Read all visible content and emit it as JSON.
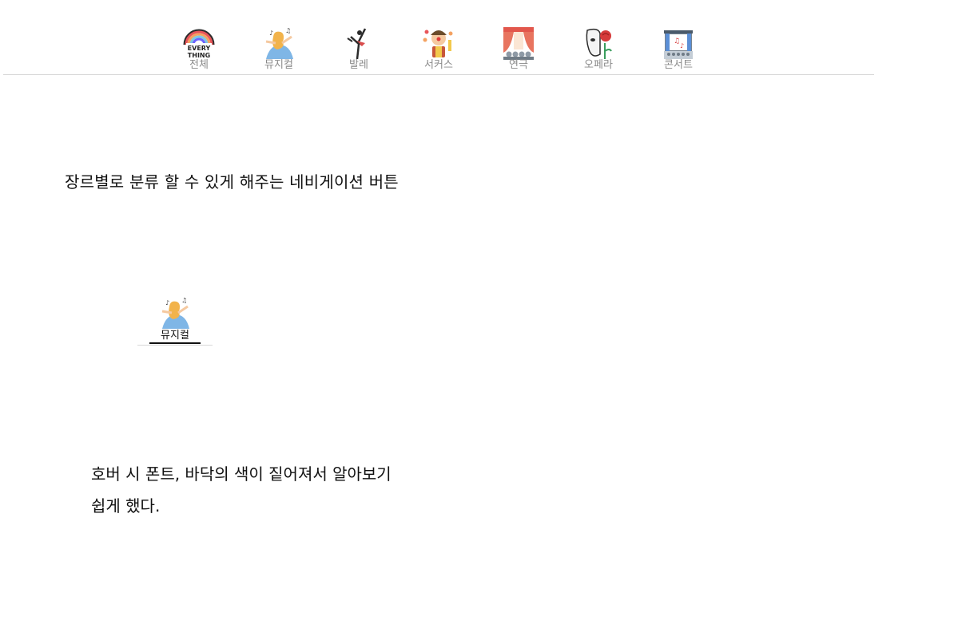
{
  "nav": {
    "items": [
      {
        "label": "전체",
        "icon": "everything-rainbow-icon"
      },
      {
        "label": "뮤지컬",
        "icon": "musical-singer-icon"
      },
      {
        "label": "발레",
        "icon": "ballet-dancer-icon"
      },
      {
        "label": "서커스",
        "icon": "circus-clown-icon"
      },
      {
        "label": "연극",
        "icon": "theater-curtain-icon"
      },
      {
        "label": "오페라",
        "icon": "opera-mask-rose-icon"
      },
      {
        "label": "콘서트",
        "icon": "concert-stage-icon"
      }
    ],
    "everything_badge": [
      "EVERY",
      "THING"
    ]
  },
  "caption": "장르별로 분류 할 수 있게 해주는 네비게이션 버튼",
  "demo": {
    "label": "뮤지컬",
    "icon": "musical-singer-icon"
  },
  "description": {
    "line1": "호버 시 폰트, 바닥의 색이 짙어져서 알아보기",
    "line2": "쉽게 했다."
  },
  "colors": {
    "label_gray": "#8a8a8a",
    "divider": "#d8d8d8",
    "text": "#111111"
  }
}
